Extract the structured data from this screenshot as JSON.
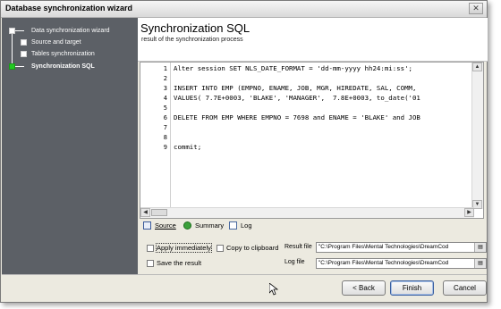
{
  "window": {
    "title": "Database synchronization wizard",
    "close_glyph": "✕"
  },
  "sidebar": {
    "items": [
      {
        "label": "Data synchronization wizard",
        "active": false
      },
      {
        "label": "Source and target",
        "active": false
      },
      {
        "label": "Tables synchronization",
        "active": false
      },
      {
        "label": "Synchronization SQL",
        "active": true
      }
    ]
  },
  "header": {
    "title": "Synchronization SQL",
    "subtitle": "result of the synchronization process"
  },
  "editor": {
    "line_numbers": [
      "1",
      "2",
      "3",
      "4",
      "5",
      "6",
      "7",
      "8",
      "9"
    ],
    "lines": [
      "Alter session SET NLS_DATE_FORMAT = 'dd-mm-yyyy hh24:mi:ss';",
      "",
      "INSERT INTO EMP (EMPNO, ENAME, JOB, MGR, HIREDATE, SAL, COMM,",
      "VALUES( 7.7E+0003, 'BLAKE', 'MANAGER',  7.8E+0003, to_date('01",
      "",
      "DELETE FROM EMP WHERE EMPNO = 7698 and ENAME = 'BLAKE' and JOB",
      "",
      "",
      "commit;"
    ]
  },
  "tabs": [
    {
      "label": "Source",
      "icon": "source-icon"
    },
    {
      "label": "Summary",
      "icon": "summary-icon"
    },
    {
      "label": "Log",
      "icon": "log-icon"
    }
  ],
  "options": {
    "apply_immediately": "Apply immediately",
    "copy_to_clipboard": "Copy to clipboard",
    "save_result": "Save the result",
    "result_file_label": "Result file",
    "result_file_value": "\"C:\\Program Files\\Mental Technologies\\DreamCod",
    "log_file_label": "Log file",
    "log_file_value": "\"C:\\Program Files\\Mental Technologies\\DreamCod"
  },
  "buttons": {
    "back": "< Back",
    "finish": "Finish",
    "cancel": "Cancel"
  }
}
